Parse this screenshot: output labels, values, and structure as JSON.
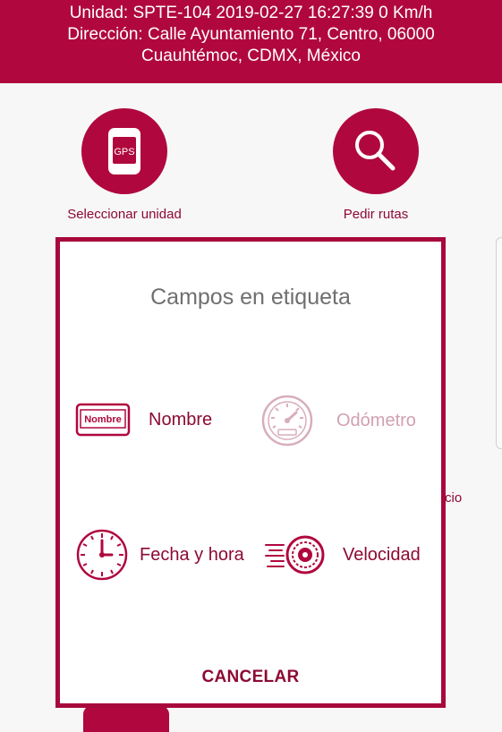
{
  "header": {
    "line1": "Unidad: SPTE-104 2019-02-27 16:27:39 0 Km/h",
    "line2": "Dirección: Calle Ayuntamiento 71, Centro, 06000",
    "line3": "Cuauhtémoc, CDMX, México"
  },
  "actions": {
    "select_unit": {
      "label": "Seleccionar unidad",
      "icon_text": "GPS",
      "icon": "gps-device-icon"
    },
    "request_routes": {
      "label": "Pedir rutas",
      "icon": "search-icon"
    }
  },
  "background": {
    "peek_text": "cio"
  },
  "dialog": {
    "title": "Campos en etiqueta",
    "options": {
      "name": {
        "label": "Nombre",
        "icon_text": "Nombre",
        "icon": "name-card-icon",
        "enabled": true
      },
      "odometer": {
        "label": "Odómetro",
        "icon": "odometer-icon",
        "enabled": false
      },
      "datetime": {
        "label": "Fecha y hora",
        "icon": "clock-icon",
        "enabled": true
      },
      "speed": {
        "label": "Velocidad",
        "icon": "speed-wheel-icon",
        "enabled": true
      }
    },
    "cancel_label": "CANCELAR"
  },
  "colors": {
    "brand": "#b0083e",
    "text_accent": "#8c0a33",
    "disabled": "#d2a0b0"
  }
}
